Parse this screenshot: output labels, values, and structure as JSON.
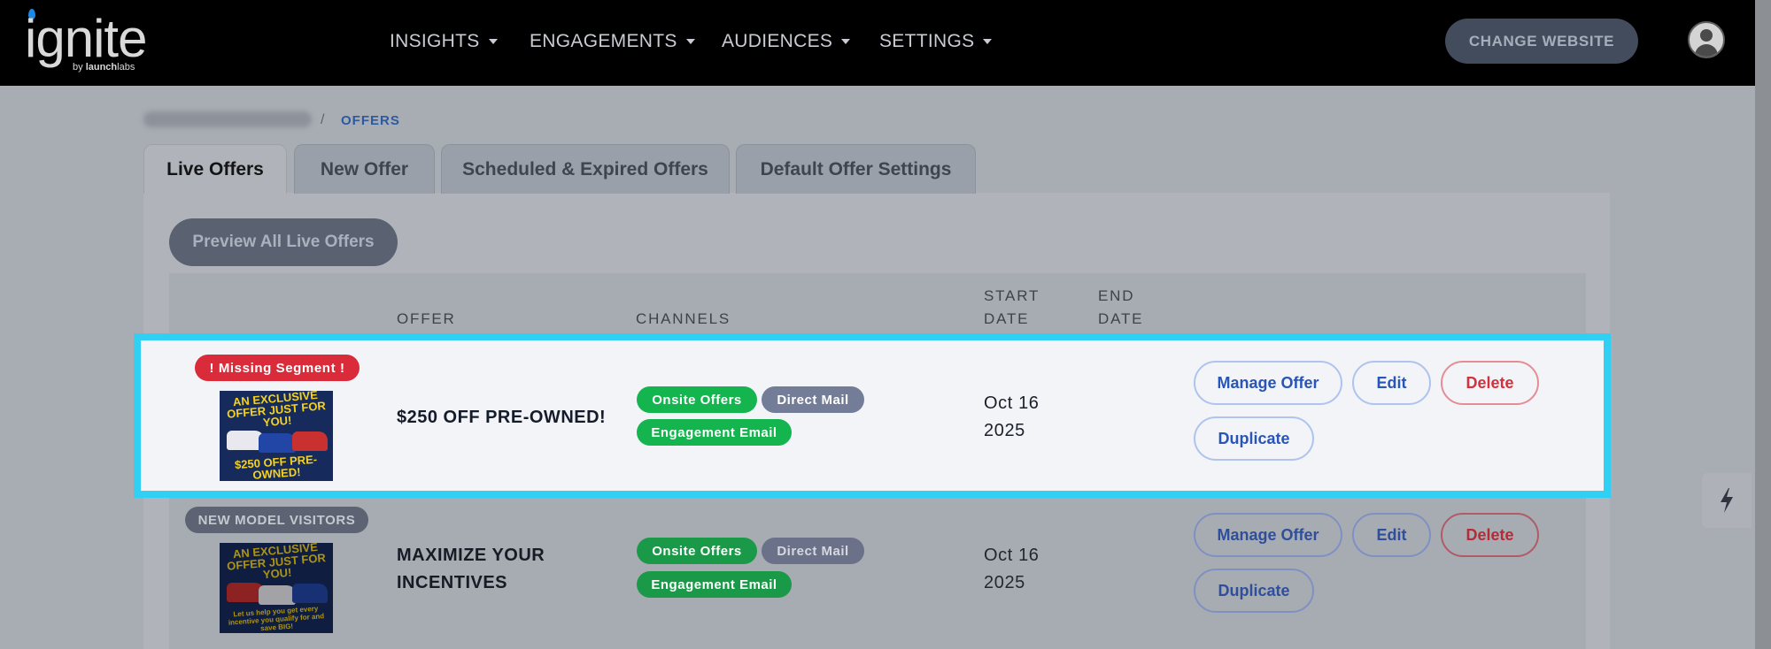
{
  "brand": {
    "logo_word": "ignite",
    "logo_by_prefix": "by ",
    "logo_by_bold": "launch",
    "logo_by_suffix": "labs"
  },
  "nav": {
    "items": [
      {
        "label": "INSIGHTS"
      },
      {
        "label": "ENGAGEMENTS"
      },
      {
        "label": "AUDIENCES"
      },
      {
        "label": "SETTINGS"
      }
    ],
    "change_website": "CHANGE WEBSITE"
  },
  "breadcrumb": {
    "separator": "/",
    "current": "OFFERS"
  },
  "tabs": [
    {
      "label": "Live Offers",
      "active": true
    },
    {
      "label": "New Offer"
    },
    {
      "label": "Scheduled & Expired Offers"
    },
    {
      "label": "Default Offer Settings"
    }
  ],
  "preview_button": "Preview All Live Offers",
  "table": {
    "headers": {
      "offer": "OFFER",
      "channels": "CHANNELS",
      "start_1": "START",
      "start_2": "DATE",
      "end_1": "END",
      "end_2": "DATE"
    }
  },
  "rows": [
    {
      "segment_badge": "! Missing Segment !",
      "segment_color": "#d92b3a",
      "thumb_top": "AN EXCLUSIVE OFFER JUST FOR YOU!",
      "thumb_bottom": "$250 OFF PRE-OWNED!",
      "title": "$250 OFF PRE-OWNED!",
      "channels": [
        "Onsite Offers",
        "Direct Mail",
        "Engagement Email"
      ],
      "start_month_day": "Oct 16",
      "start_year": "2025",
      "actions": {
        "manage": "Manage Offer",
        "edit": "Edit",
        "delete": "Delete",
        "duplicate": "Duplicate"
      }
    },
    {
      "segment_badge": "NEW MODEL VISITORS",
      "segment_color": "#5d6373",
      "thumb_top": "AN EXCLUSIVE OFFER JUST FOR YOU!",
      "thumb_bottom": "Let us help you get every incentive you qualify for and save BIG!",
      "title_line1": "MAXIMIZE YOUR",
      "title_line2": "INCENTIVES",
      "channels": [
        "Onsite Offers",
        "Direct Mail",
        "Engagement Email"
      ],
      "start_month_day": "Oct 16",
      "start_year": "2025",
      "actions": {
        "manage": "Manage Offer",
        "edit": "Edit",
        "delete": "Delete",
        "duplicate": "Duplicate"
      }
    }
  ],
  "icons": {
    "profile": "user-circle-icon",
    "bolt": "lightning-bolt-icon",
    "caret": "caret-down-icon"
  },
  "colors": {
    "highlight": "#30d0f4",
    "green_chip": "#14b44e",
    "slate_chip": "#747d97",
    "danger": "#d92b3a"
  }
}
